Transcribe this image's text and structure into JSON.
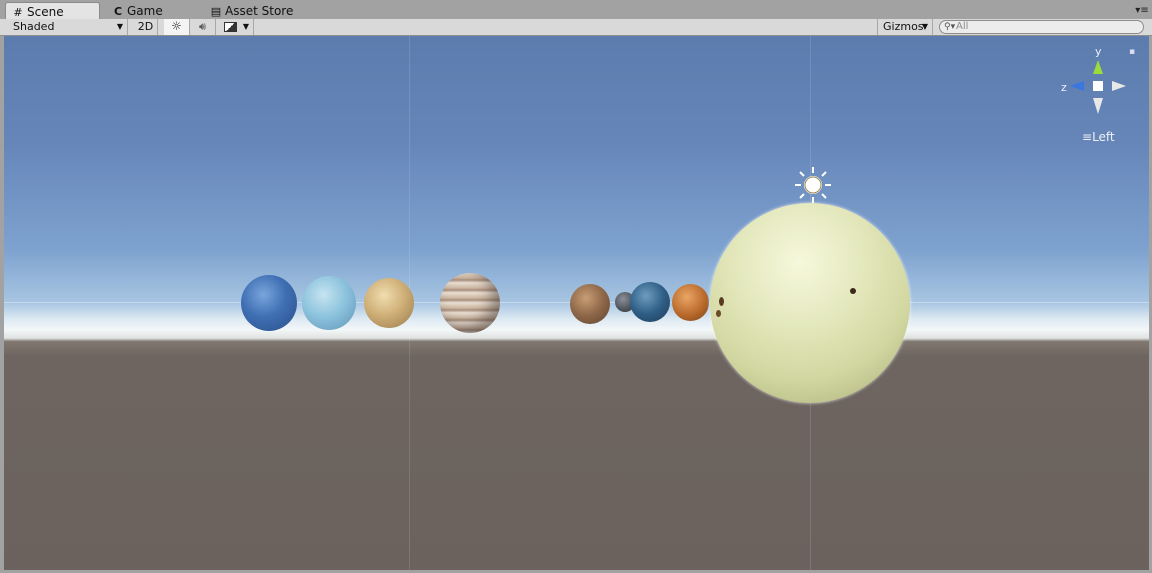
{
  "tabs": [
    {
      "label": "Scene",
      "icon": "grid-icon",
      "active": true
    },
    {
      "label": "Game",
      "icon": "pacman-icon",
      "active": false
    },
    {
      "label": "Asset Store",
      "icon": "store-icon",
      "active": false
    }
  ],
  "toolbar": {
    "shading_mode": "Shaded",
    "mode_2d": "2D",
    "gizmos": "Gizmos",
    "search_placeholder": "All"
  },
  "gizmo": {
    "y_axis": "y",
    "z_axis": "z",
    "view_label": "Left"
  },
  "colors": {
    "sky_top": "#5c7cae",
    "horizon": "#f3f7f8",
    "ground": "#6b625e",
    "tab_active": "#e4e4e4",
    "toolbar": "#d9d9d9"
  }
}
